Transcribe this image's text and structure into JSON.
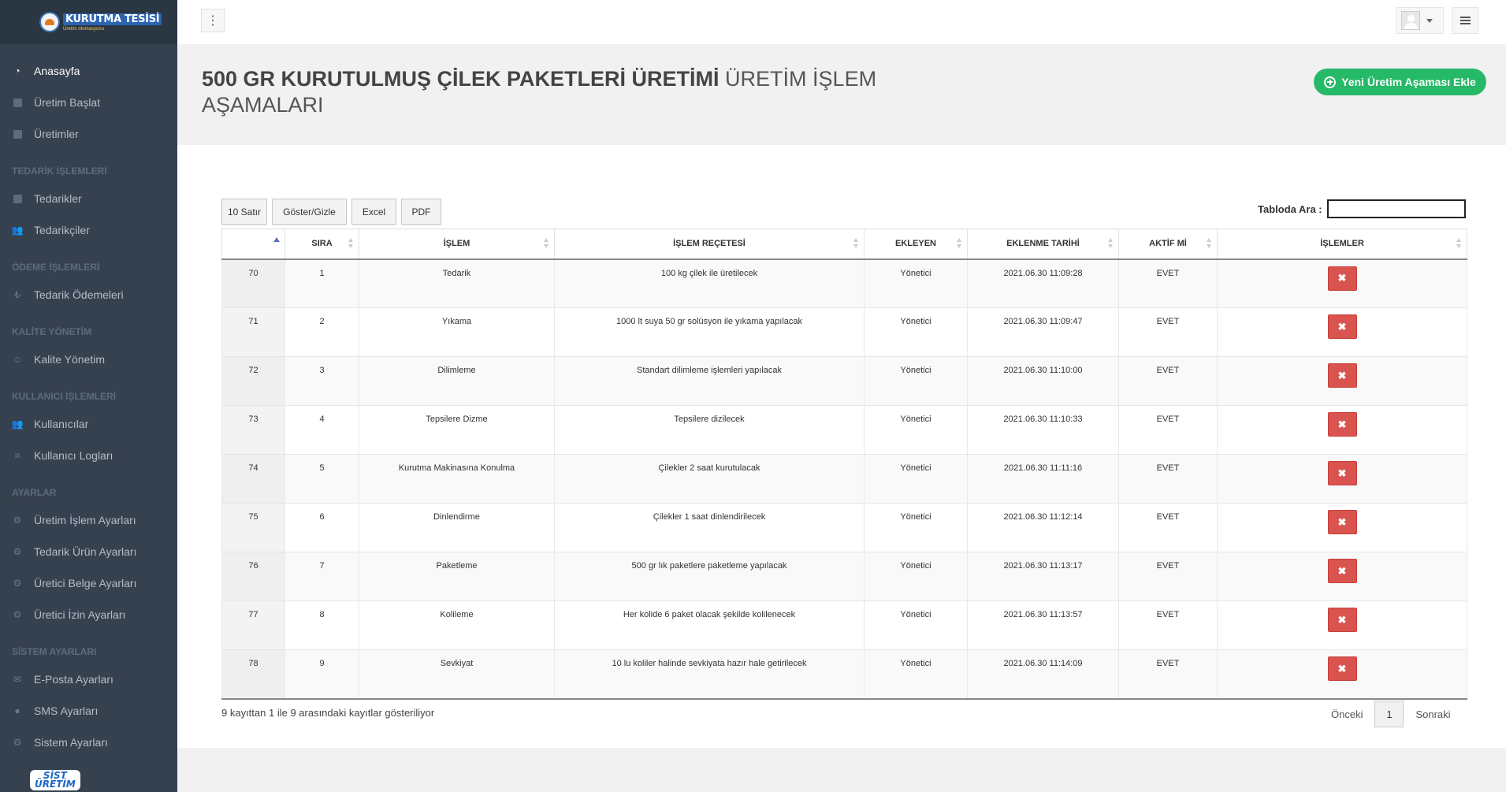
{
  "brand": {
    "line1": "KURUTMA TESİSİ",
    "line2": "Üretim otomasyonu"
  },
  "sidebar": {
    "groups": [
      {
        "head": "",
        "items": [
          {
            "label": "Anasayfa",
            "icon": "dashboard-icon",
            "active": true
          },
          {
            "label": "Üretim Başlat",
            "icon": "square-icon"
          },
          {
            "label": "Üretimler",
            "icon": "square-icon"
          }
        ]
      },
      {
        "head": "TEDARİK İŞLEMLERİ",
        "items": [
          {
            "label": "Tedarikler",
            "icon": "square-icon"
          },
          {
            "label": "Tedarikçiler",
            "icon": "users-icon"
          }
        ]
      },
      {
        "head": "ÖDEME İŞLEMLERİ",
        "items": [
          {
            "label": "Tedarik Ödemeleri",
            "icon": "money-icon"
          }
        ]
      },
      {
        "head": "KALİTE YÖNETİM",
        "items": [
          {
            "label": "Kalite Yönetim",
            "icon": "smile-icon"
          }
        ]
      },
      {
        "head": "KULLANICI İŞLEMLERİ",
        "items": [
          {
            "label": "Kullanıcılar",
            "icon": "users-icon"
          },
          {
            "label": "Kullanıcı Logları",
            "icon": "list-icon"
          }
        ]
      },
      {
        "head": "AYARLAR",
        "items": [
          {
            "label": "Üretim İşlem Ayarları",
            "icon": "gears-icon"
          },
          {
            "label": "Tedarik Ürün Ayarları",
            "icon": "gears-icon"
          },
          {
            "label": "Üretici Belge Ayarları",
            "icon": "gears-icon"
          },
          {
            "label": "Üretici İzin Ayarları",
            "icon": "gears-icon"
          }
        ]
      },
      {
        "head": "SİSTEM AYARLARI",
        "items": [
          {
            "label": "E-Posta Ayarları",
            "icon": "envelope-icon"
          },
          {
            "label": "SMS Ayarları",
            "icon": "comment-icon"
          },
          {
            "label": "Sistem Ayarları",
            "icon": "gears-icon"
          }
        ]
      }
    ],
    "footer_logo_line1": "SİST",
    "footer_logo_line2": "ÜRETİM"
  },
  "header": {
    "title_bold": "500 GR KURUTULMUŞ ÇİLEK PAKETLERİ ÜRETİMİ",
    "title_light": "ÜRETİM İŞLEM AŞAMALARI",
    "add_button": "Yeni Üretim Aşaması Ekle"
  },
  "toolbar": {
    "rows_button": "10 Satır",
    "toggle_button": "Göster/Gizle",
    "excel_button": "Excel",
    "pdf_button": "PDF",
    "search_label": "Tabloda Ara :",
    "search_value": ""
  },
  "table": {
    "columns": [
      "",
      "SIRA",
      "İŞLEM",
      "İŞLEM REÇETESİ",
      "EKLEYEN",
      "EKLENME TARİHİ",
      "AKTİF Mİ",
      "İŞLEMLER"
    ],
    "rows": [
      {
        "id": "70",
        "sira": "1",
        "islem": "Tedarik",
        "recete": "100 kg çilek ile üretilecek",
        "ekleyen": "Yönetici",
        "tarih": "2021.06.30 11:09:28",
        "aktif": "EVET"
      },
      {
        "id": "71",
        "sira": "2",
        "islem": "Yıkama",
        "recete": "1000 lt suya 50 gr solüsyon ile yıkama yapılacak",
        "ekleyen": "Yönetici",
        "tarih": "2021.06.30 11:09:47",
        "aktif": "EVET"
      },
      {
        "id": "72",
        "sira": "3",
        "islem": "Dilimleme",
        "recete": "Standart dilimleme işlemleri yapılacak",
        "ekleyen": "Yönetici",
        "tarih": "2021.06.30 11:10:00",
        "aktif": "EVET"
      },
      {
        "id": "73",
        "sira": "4",
        "islem": "Tepsilere Dizme",
        "recete": "Tepsilere dizilecek",
        "ekleyen": "Yönetici",
        "tarih": "2021.06.30 11:10:33",
        "aktif": "EVET"
      },
      {
        "id": "74",
        "sira": "5",
        "islem": "Kurutma Makinasına Konulma",
        "recete": "Çilekler 2 saat kurutulacak",
        "ekleyen": "Yönetici",
        "tarih": "2021.06.30 11:11:16",
        "aktif": "EVET"
      },
      {
        "id": "75",
        "sira": "6",
        "islem": "Dinlendirme",
        "recete": "Çilekler 1 saat dinlendirilecek",
        "ekleyen": "Yönetici",
        "tarih": "2021.06.30 11:12:14",
        "aktif": "EVET"
      },
      {
        "id": "76",
        "sira": "7",
        "islem": "Paketleme",
        "recete": "500 gr lık paketlere paketleme yapılacak",
        "ekleyen": "Yönetici",
        "tarih": "2021.06.30 11:13:17",
        "aktif": "EVET"
      },
      {
        "id": "77",
        "sira": "8",
        "islem": "Kolileme",
        "recete": "Her kolide 6 paket olacak şekilde kolilenecek",
        "ekleyen": "Yönetici",
        "tarih": "2021.06.30 11:13:57",
        "aktif": "EVET"
      },
      {
        "id": "78",
        "sira": "9",
        "islem": "Sevkiyat",
        "recete": "10 lu koliler halinde sevkiyata hazır hale getirilecek",
        "ekleyen": "Yönetici",
        "tarih": "2021.06.30 11:14:09",
        "aktif": "EVET"
      }
    ],
    "delete_glyph": "✖"
  },
  "footer": {
    "info": "9 kayıttan 1 ile 9 arasındaki kayıtlar gösteriliyor",
    "prev": "Önceki",
    "page": "1",
    "next": "Sonraki"
  },
  "colors": {
    "sidebar_bg": "#364150",
    "accent_green": "#26b968",
    "delete_red": "#d9534f"
  }
}
